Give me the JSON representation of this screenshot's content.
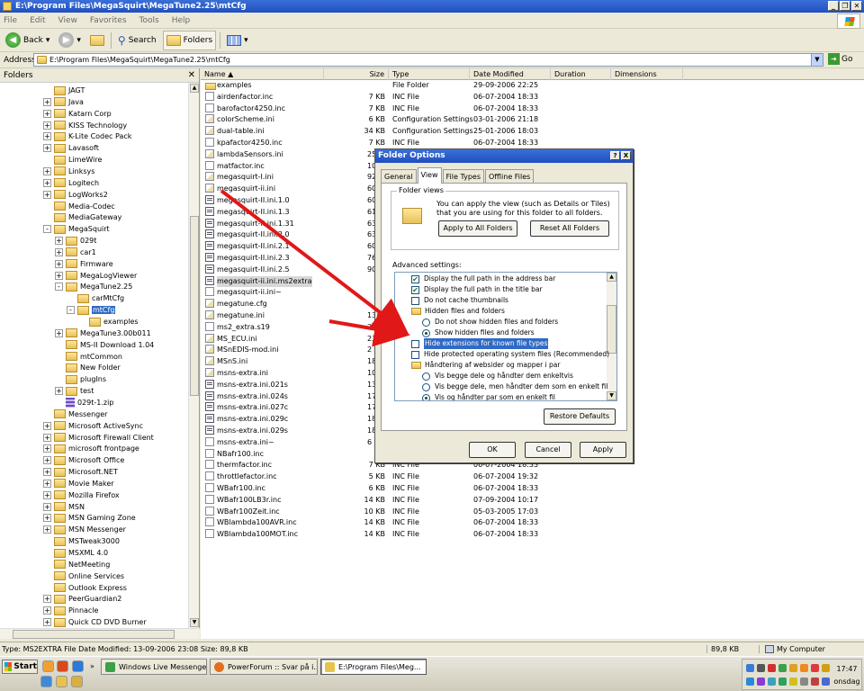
{
  "window": {
    "title": "E:\\Program Files\\MegaSquirt\\MegaTune2.25\\mtCfg"
  },
  "menu": [
    "File",
    "Edit",
    "View",
    "Favorites",
    "Tools",
    "Help"
  ],
  "toolbar": {
    "back": "Back",
    "search": "Search",
    "folders": "Folders"
  },
  "address": {
    "label": "Address",
    "value": "E:\\Program Files\\MegaSquirt\\MegaTune2.25\\mtCfg",
    "go": "Go"
  },
  "folders_pane": {
    "title": "Folders",
    "items": [
      {
        "label": "JAGT",
        "expander": ""
      },
      {
        "label": "Java",
        "expander": "+"
      },
      {
        "label": "Katarn Corp",
        "expander": "+"
      },
      {
        "label": "KISS Technology",
        "expander": "+"
      },
      {
        "label": "K-Lite Codec Pack",
        "expander": "+"
      },
      {
        "label": "Lavasoft",
        "expander": "+"
      },
      {
        "label": "LimeWire",
        "expander": ""
      },
      {
        "label": "Linksys",
        "expander": "+"
      },
      {
        "label": "Logitech",
        "expander": "+"
      },
      {
        "label": "LogWorks2",
        "expander": "+"
      },
      {
        "label": "Media-Codec",
        "expander": ""
      },
      {
        "label": "MediaGateway",
        "expander": ""
      },
      {
        "label": "MegaSquirt",
        "expander": "-"
      },
      {
        "label": "029t",
        "expander": "+"
      },
      {
        "label": "car1",
        "expander": "+"
      },
      {
        "label": "Firmware",
        "expander": "+"
      },
      {
        "label": "MegaLogViewer",
        "expander": "+"
      },
      {
        "label": "MegaTune2.25",
        "expander": "-"
      },
      {
        "label": "carMtCfg",
        "expander": ""
      },
      {
        "label": "mtCfg",
        "expander": "-"
      },
      {
        "label": "examples",
        "expander": ""
      },
      {
        "label": "MegaTune3.00b011",
        "expander": "+"
      },
      {
        "label": "MS-II Download 1.04",
        "expander": ""
      },
      {
        "label": "mtCommon",
        "expander": ""
      },
      {
        "label": "New Folder",
        "expander": ""
      },
      {
        "label": "plugIns",
        "expander": ""
      },
      {
        "label": "test",
        "expander": "+"
      },
      {
        "label": "029t-1.zip",
        "expander": ""
      },
      {
        "label": "Messenger",
        "expander": ""
      },
      {
        "label": "Microsoft ActiveSync",
        "expander": "+"
      },
      {
        "label": "Microsoft Firewall Client",
        "expander": "+"
      },
      {
        "label": "microsoft frontpage",
        "expander": "+"
      },
      {
        "label": "Microsoft Office",
        "expander": "+"
      },
      {
        "label": "Microsoft.NET",
        "expander": "+"
      },
      {
        "label": "Movie Maker",
        "expander": "+"
      },
      {
        "label": "Mozilla Firefox",
        "expander": "+"
      },
      {
        "label": "MSN",
        "expander": "+"
      },
      {
        "label": "MSN Gaming Zone",
        "expander": "+"
      },
      {
        "label": "MSN Messenger",
        "expander": "+"
      },
      {
        "label": "MSTweak3000",
        "expander": ""
      },
      {
        "label": "MSXML 4.0",
        "expander": ""
      },
      {
        "label": "NetMeeting",
        "expander": ""
      },
      {
        "label": "Online Services",
        "expander": ""
      },
      {
        "label": "Outlook Express",
        "expander": ""
      },
      {
        "label": "PeerGuardian2",
        "expander": "+"
      },
      {
        "label": "Pinnacle",
        "expander": "+"
      },
      {
        "label": "Quick CD DVD Burner",
        "expander": "+"
      },
      {
        "label": "QuickTime",
        "expander": "+"
      }
    ]
  },
  "file_list": {
    "columns": [
      "Name",
      "Size",
      "Type",
      "Date Modified",
      "Duration",
      "Dimensions"
    ],
    "rows": [
      {
        "name": "examples",
        "size": "",
        "type": "File Folder",
        "date": "29-09-2006 22:25",
        "icon": "folder"
      },
      {
        "name": "airdenfactor.inc",
        "size": "7 KB",
        "type": "INC File",
        "date": "06-07-2004 18:33",
        "icon": "doc"
      },
      {
        "name": "barofactor4250.inc",
        "size": "7 KB",
        "type": "INC File",
        "date": "06-07-2004 18:33",
        "icon": "doc"
      },
      {
        "name": "colorScheme.ini",
        "size": "6 KB",
        "type": "Configuration Settings",
        "date": "03-01-2006 21:18",
        "icon": "cfg"
      },
      {
        "name": "dual-table.ini",
        "size": "34 KB",
        "type": "Configuration Settings",
        "date": "25-01-2006 18:03",
        "icon": "cfg"
      },
      {
        "name": "kpafactor4250.inc",
        "size": "7 KB",
        "type": "INC File",
        "date": "06-07-2004 18:33",
        "icon": "doc"
      },
      {
        "name": "lambdaSensors.ini",
        "size": "",
        "type": "",
        "date": "",
        "icon": "cfg"
      },
      {
        "name": "matfactor.inc",
        "size": "",
        "type": "",
        "date": "",
        "icon": "doc"
      },
      {
        "name": "megasquirt-I.ini",
        "size": "",
        "type": "",
        "date": "",
        "icon": "cfg"
      },
      {
        "name": "megasquirt-ii.ini",
        "size": "",
        "type": "",
        "date": "",
        "icon": "cfg"
      },
      {
        "name": "megasquirt-II.ini.1.0",
        "size": "",
        "type": "",
        "date": "",
        "icon": "ini"
      },
      {
        "name": "megasquirt-II.ini.1.3",
        "size": "",
        "type": "",
        "date": "",
        "icon": "ini"
      },
      {
        "name": "megasquirt-II.ini.1.31",
        "size": "",
        "type": "",
        "date": "",
        "icon": "ini"
      },
      {
        "name": "megasquirt-II.ini.2.0",
        "size": "",
        "type": "",
        "date": "",
        "icon": "ini"
      },
      {
        "name": "megasquirt-II.ini.2.1",
        "size": "",
        "type": "",
        "date": "",
        "icon": "ini"
      },
      {
        "name": "megasquirt-II.ini.2.3",
        "size": "",
        "type": "",
        "date": "",
        "icon": "ini"
      },
      {
        "name": "megasquirt-II.ini.2.5",
        "size": "",
        "type": "",
        "date": "",
        "icon": "ini"
      },
      {
        "name": "megasquirt-ii.ini.ms2extra",
        "size": "",
        "type": "",
        "date": "",
        "icon": "ini"
      },
      {
        "name": "megasquirt-ii.ini~",
        "size": "",
        "type": "",
        "date": "",
        "icon": "doc"
      },
      {
        "name": "megatune.cfg",
        "size": "",
        "type": "",
        "date": "",
        "icon": "cfg"
      },
      {
        "name": "megatune.ini",
        "size": "",
        "type": "",
        "date": "",
        "icon": "cfg"
      },
      {
        "name": "ms2_extra.s19",
        "size": "",
        "type": "",
        "date": "",
        "icon": "doc"
      },
      {
        "name": "MS_ECU.ini",
        "size": "",
        "type": "",
        "date": "",
        "icon": "cfg"
      },
      {
        "name": "MSnEDIS-mod.ini",
        "size": "",
        "type": "",
        "date": "",
        "icon": "cfg"
      },
      {
        "name": "MSnS.ini",
        "size": "",
        "type": "",
        "date": "",
        "icon": "cfg"
      },
      {
        "name": "msns-extra.ini",
        "size": "",
        "type": "",
        "date": "",
        "icon": "cfg"
      },
      {
        "name": "msns-extra.ini.021s",
        "size": "",
        "type": "",
        "date": "",
        "icon": "ini"
      },
      {
        "name": "msns-extra.ini.024s",
        "size": "",
        "type": "",
        "date": "",
        "icon": "ini"
      },
      {
        "name": "msns-extra.ini.027c",
        "size": "",
        "type": "",
        "date": "",
        "icon": "ini"
      },
      {
        "name": "msns-extra.ini.029c",
        "size": "",
        "type": "",
        "date": "",
        "icon": "ini"
      },
      {
        "name": "msns-extra.ini.029s",
        "size": "",
        "type": "",
        "date": "",
        "icon": "ini"
      },
      {
        "name": "msns-extra.ini~",
        "size": "",
        "type": "",
        "date": "",
        "icon": "doc"
      },
      {
        "name": "NBafr100.inc",
        "size": "",
        "type": "",
        "date": "",
        "icon": "doc"
      },
      {
        "name": "thermfactor.inc",
        "size": "7 KB",
        "type": "INC File",
        "date": "06-07-2004 18:33",
        "icon": "doc"
      },
      {
        "name": "throttlefactor.inc",
        "size": "5 KB",
        "type": "INC File",
        "date": "06-07-2004 19:32",
        "icon": "doc"
      },
      {
        "name": "WBafr100.inc",
        "size": "6 KB",
        "type": "INC File",
        "date": "06-07-2004 18:33",
        "icon": "doc"
      },
      {
        "name": "WBafr100LB3r.inc",
        "size": "14 KB",
        "type": "INC File",
        "date": "07-09-2004 10:17",
        "icon": "doc"
      },
      {
        "name": "WBafr100Zeit.inc",
        "size": "10 KB",
        "type": "INC File",
        "date": "05-03-2005 17:03",
        "icon": "doc"
      },
      {
        "name": "WBlambda100AVR.inc",
        "size": "14 KB",
        "type": "INC File",
        "date": "06-07-2004 18:33",
        "icon": "doc"
      },
      {
        "name": "WBlambda100MOT.inc",
        "size": "14 KB",
        "type": "INC File",
        "date": "06-07-2004 18:33",
        "icon": "doc"
      }
    ],
    "partial_sizes": [
      "25",
      "10",
      "92",
      "60",
      "60",
      "61",
      "63",
      "63",
      "60",
      "76",
      "90",
      "",
      "",
      "",
      "13",
      "23",
      "23",
      "2",
      "18",
      "10",
      "13",
      "17",
      "17",
      "18",
      "18",
      "6"
    ]
  },
  "dialog": {
    "title": "Folder Options",
    "tabs": [
      "General",
      "View",
      "File Types",
      "Offline Files"
    ],
    "folder_views_legend": "Folder views",
    "folder_views_desc": "You can apply the view (such as Details or Tiles) that you are using for this folder to all folders.",
    "apply_all": "Apply to All Folders",
    "reset_all": "Reset All Folders",
    "advanced_label": "Advanced settings:",
    "advanced": [
      {
        "kind": "check",
        "on": true,
        "label": "Display the full path in the address bar"
      },
      {
        "kind": "check",
        "on": true,
        "label": "Display the full path in the title bar"
      },
      {
        "kind": "check",
        "on": false,
        "label": "Do not cache thumbnails"
      },
      {
        "kind": "folder",
        "on": false,
        "label": "Hidden files and folders"
      },
      {
        "kind": "radio",
        "on": false,
        "label": "Do not show hidden files and folders"
      },
      {
        "kind": "radio",
        "on": true,
        "label": "Show hidden files and folders"
      },
      {
        "kind": "check",
        "on": false,
        "label": "Hide extensions for known file types",
        "selected": true
      },
      {
        "kind": "check",
        "on": false,
        "label": "Hide protected operating system files (Recommended)"
      },
      {
        "kind": "folder",
        "on": false,
        "label": "Håndtering af websider og mapper i par"
      },
      {
        "kind": "radio",
        "on": false,
        "label": "Vis begge dele og håndter dem enkeltvis"
      },
      {
        "kind": "radio",
        "on": false,
        "label": "Vis begge dele, men håndter dem som en enkelt fil"
      },
      {
        "kind": "radio",
        "on": true,
        "label": "Vis og håndter par som en enkelt fil"
      }
    ],
    "restore": "Restore Defaults",
    "ok": "OK",
    "cancel": "Cancel",
    "apply": "Apply",
    "help_btn": "?",
    "close_btn": "X"
  },
  "status": {
    "text": "Type: MS2EXTRA File Date Modified: 13-09-2006 23:08 Size: 89,8 KB",
    "size": "89,8 KB",
    "location": "My Computer"
  },
  "taskbar": {
    "start": "Start",
    "tasks": [
      "Windows Live Messenger",
      "PowerForum :: Svar på i...",
      "E:\\Program Files\\Meg..."
    ],
    "time": "17:47",
    "day": "onsdag"
  },
  "colors": {
    "accent": "#316ac5",
    "arrow": "#e01818",
    "titlebar": "#1f4fbf"
  }
}
